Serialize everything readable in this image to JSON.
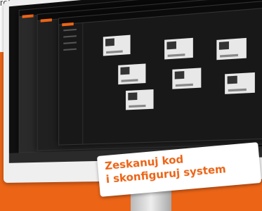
{
  "page": {
    "top_text": "roka",
    "accent_color": "#ec6416"
  },
  "monitor": {
    "screen_windows": [
      "window-back",
      "window-middle",
      "window-front"
    ]
  },
  "sticker": {
    "line1": "Zeskanuj kod",
    "line2": "i skonfiguruj system"
  }
}
